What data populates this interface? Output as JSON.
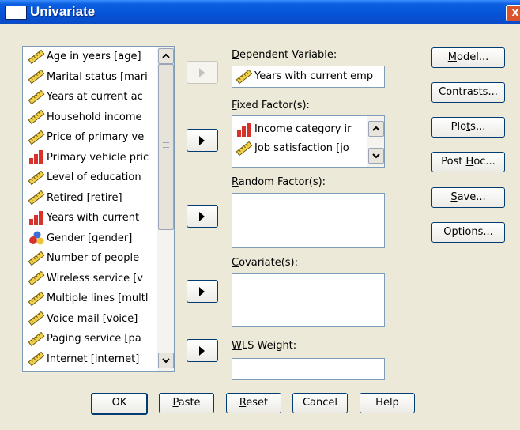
{
  "window": {
    "title": "Univariate",
    "close_glyph": "x"
  },
  "source_list": {
    "items": [
      {
        "label": "Age in years [age]",
        "icon": "scale-ruler-icon"
      },
      {
        "label": "Marital status [mari",
        "icon": "scale-ruler-icon"
      },
      {
        "label": "Years at current ac",
        "icon": "scale-ruler-icon"
      },
      {
        "label": "Household income",
        "icon": "scale-ruler-icon"
      },
      {
        "label": "Price of primary ve",
        "icon": "scale-ruler-icon"
      },
      {
        "label": "Primary vehicle pric",
        "icon": "ordinal-bars-icon"
      },
      {
        "label": "Level of education",
        "icon": "scale-ruler-icon"
      },
      {
        "label": "Retired [retire]",
        "icon": "scale-ruler-icon"
      },
      {
        "label": "Years with current",
        "icon": "ordinal-bars-icon"
      },
      {
        "label": "Gender [gender]",
        "icon": "nominal-balls-icon"
      },
      {
        "label": "Number of people",
        "icon": "scale-ruler-icon"
      },
      {
        "label": "Wireless service [v",
        "icon": "scale-ruler-icon"
      },
      {
        "label": "Multiple lines [multl",
        "icon": "scale-ruler-icon"
      },
      {
        "label": "Voice mail [voice]",
        "icon": "scale-ruler-icon"
      },
      {
        "label": "Paging service [pa",
        "icon": "scale-ruler-icon"
      },
      {
        "label": "Internet [internet]",
        "icon": "scale-ruler-icon"
      }
    ]
  },
  "dependent": {
    "label": "Dependent Variable:",
    "accel": "D",
    "rest": "ependent Variable:",
    "value": "Years with current emp",
    "icon": "scale-ruler-icon"
  },
  "fixed": {
    "accel": "F",
    "rest": "ixed Factor(s):",
    "items": [
      {
        "label": "Income category ir",
        "icon": "ordinal-bars-icon"
      },
      {
        "label": "Job satisfaction [jo",
        "icon": "scale-ruler-icon"
      }
    ]
  },
  "random": {
    "accel": "R",
    "rest": "andom Factor(s):"
  },
  "covariate": {
    "accel": "C",
    "rest": "ovariate(s):"
  },
  "wls": {
    "accel": "W",
    "rest": "LS Weight:"
  },
  "side_buttons": [
    {
      "pre": "",
      "accel": "M",
      "post": "odel..."
    },
    {
      "pre": "Co",
      "accel": "n",
      "post": "trasts..."
    },
    {
      "pre": "Plo",
      "accel": "t",
      "post": "s..."
    },
    {
      "pre": "Post ",
      "accel": "H",
      "post": "oc..."
    },
    {
      "pre": "",
      "accel": "S",
      "post": "ave..."
    },
    {
      "pre": "",
      "accel": "O",
      "post": "ptions..."
    }
  ],
  "bottom_buttons": {
    "ok": "OK",
    "paste": {
      "accel": "P",
      "post": "aste"
    },
    "reset": {
      "accel": "R",
      "post": "eset"
    },
    "cancel": "Cancel",
    "help": "Help"
  }
}
